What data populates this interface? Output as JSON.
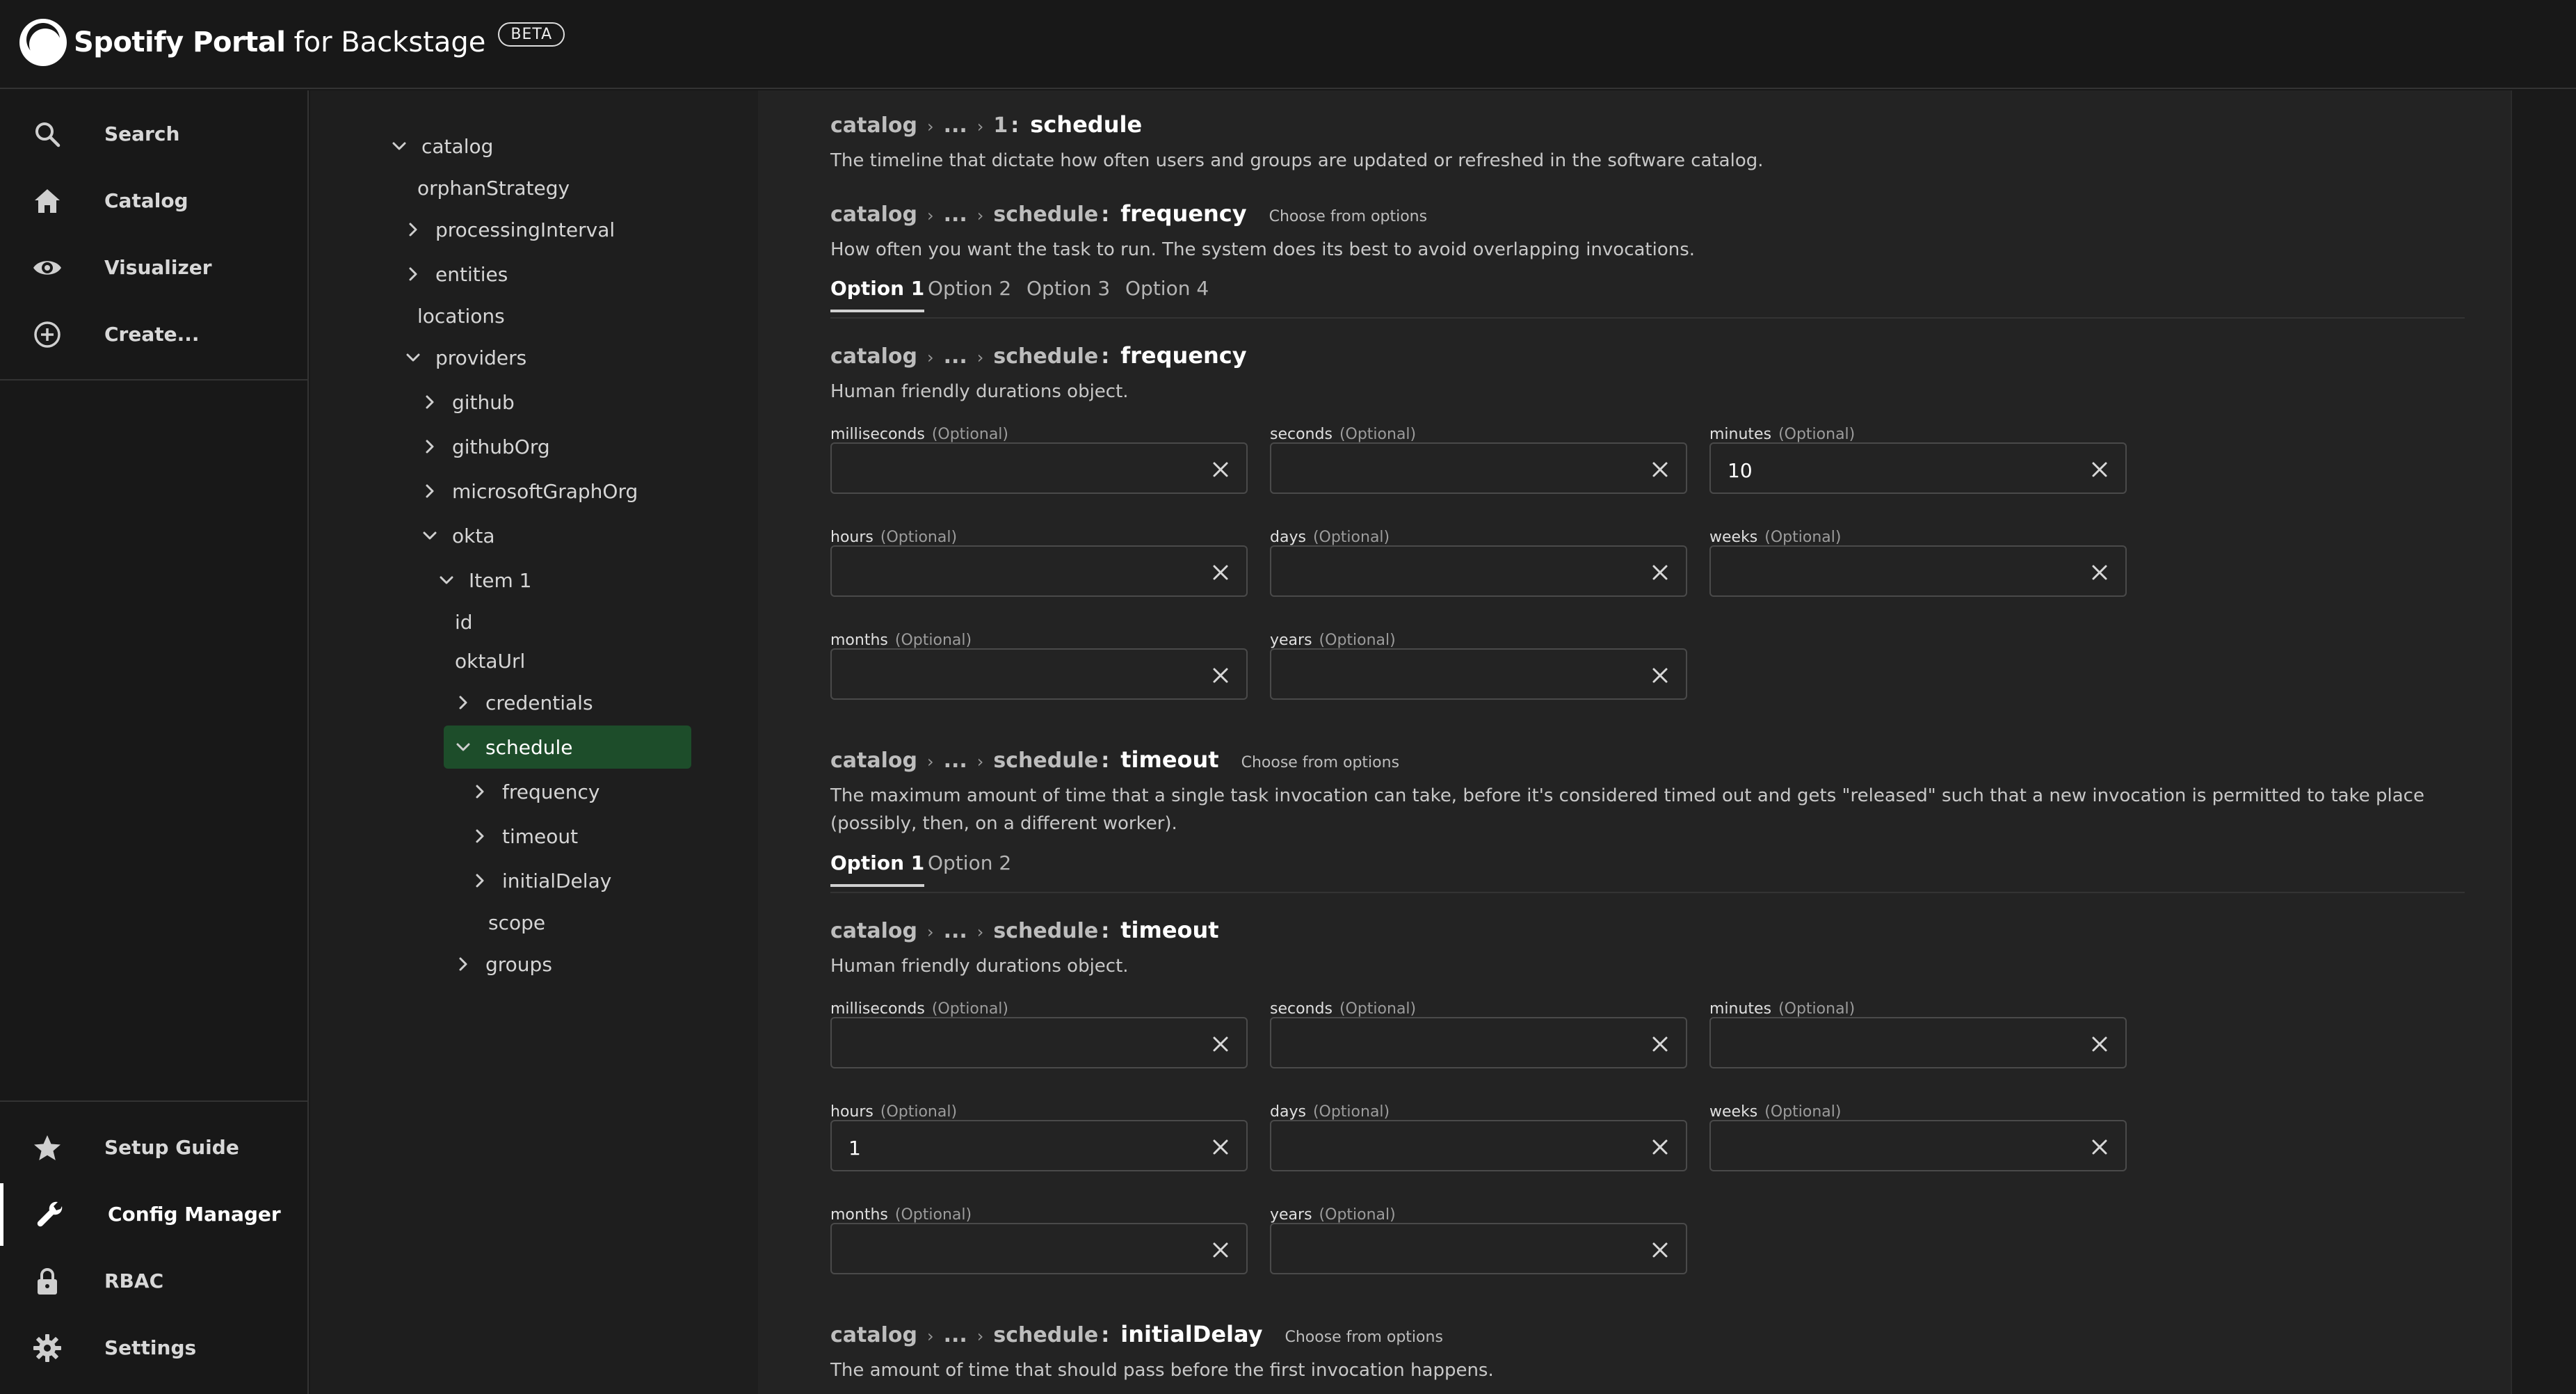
{
  "app": {
    "brand": "Spotify Portal",
    "brand_sub": "for Backstage",
    "beta": "BETA"
  },
  "nav": {
    "top": [
      {
        "label": "Search",
        "icon": "search-icon"
      },
      {
        "label": "Catalog",
        "icon": "home-icon"
      },
      {
        "label": "Visualizer",
        "icon": "eye-icon"
      },
      {
        "label": "Create...",
        "icon": "plus-circle-icon"
      }
    ],
    "bottom": [
      {
        "label": "Setup Guide",
        "icon": "star-icon"
      },
      {
        "label": "Config Manager",
        "icon": "wrench-icon",
        "active": true
      },
      {
        "label": "RBAC",
        "icon": "lock-icon"
      },
      {
        "label": "Settings",
        "icon": "gear-icon"
      }
    ]
  },
  "tree": [
    {
      "label": "catalog",
      "chev": "down"
    },
    {
      "label": "orphanStrategy",
      "chev": ""
    },
    {
      "label": "processingInterval",
      "chev": "right"
    },
    {
      "label": "entities",
      "chev": "right"
    },
    {
      "label": "locations",
      "chev": ""
    },
    {
      "label": "providers",
      "chev": "down"
    },
    {
      "label": "github",
      "chev": "right"
    },
    {
      "label": "githubOrg",
      "chev": "right"
    },
    {
      "label": "microsoftGraphOrg",
      "chev": "right"
    },
    {
      "label": "okta",
      "chev": "down"
    },
    {
      "label": "Item 1",
      "chev": "down"
    },
    {
      "label": "id",
      "chev": ""
    },
    {
      "label": "oktaUrl",
      "chev": ""
    },
    {
      "label": "credentials",
      "chev": "right"
    },
    {
      "label": "schedule",
      "chev": "down",
      "selected": true
    },
    {
      "label": "frequency",
      "chev": "right"
    },
    {
      "label": "timeout",
      "chev": "right"
    },
    {
      "label": "initialDelay",
      "chev": "right"
    },
    {
      "label": "scope",
      "chev": ""
    },
    {
      "label": "groups",
      "chev": "right"
    }
  ],
  "crumb_common": {
    "root": "catalog",
    "ellipsis": "...",
    "hint": "Choose from options"
  },
  "sections": {
    "schedule_header": {
      "parent": "1",
      "key": "schedule",
      "desc": "The timeline that dictate how often users and groups are updated or refreshed in the software catalog."
    },
    "frequency_opts": {
      "parent": "schedule",
      "key": "frequency",
      "desc": "How often you want the task to run. The system does its best to avoid overlapping invocations.",
      "tabs": [
        "Option 1",
        "Option 2",
        "Option 3",
        "Option 4"
      ]
    },
    "frequency_obj": {
      "parent": "schedule",
      "key": "frequency",
      "desc": "Human friendly durations object."
    },
    "timeout_opts": {
      "parent": "schedule",
      "key": "timeout",
      "desc": "The maximum amount of time that a single task invocation can take, before it's considered timed out and gets \"released\" such that a new invocation is permitted to take place (possibly, then, on a different worker).",
      "tabs": [
        "Option 1",
        "Option 2"
      ]
    },
    "timeout_obj": {
      "parent": "schedule",
      "key": "timeout",
      "desc": "Human friendly durations object."
    },
    "initialdelay_opts": {
      "parent": "schedule",
      "key": "initialDelay",
      "desc": "The amount of time that should pass before the first invocation happens."
    }
  },
  "optional_tag": "(Optional)",
  "frequency_fields": [
    {
      "label": "milliseconds",
      "value": ""
    },
    {
      "label": "seconds",
      "value": ""
    },
    {
      "label": "minutes",
      "value": "10"
    },
    {
      "label": "hours",
      "value": ""
    },
    {
      "label": "days",
      "value": ""
    },
    {
      "label": "weeks",
      "value": ""
    },
    {
      "label": "months",
      "value": ""
    },
    {
      "label": "years",
      "value": ""
    }
  ],
  "timeout_fields": [
    {
      "label": "milliseconds",
      "value": ""
    },
    {
      "label": "seconds",
      "value": ""
    },
    {
      "label": "minutes",
      "value": ""
    },
    {
      "label": "hours",
      "value": "1"
    },
    {
      "label": "days",
      "value": ""
    },
    {
      "label": "weeks",
      "value": ""
    },
    {
      "label": "months",
      "value": ""
    },
    {
      "label": "years",
      "value": ""
    }
  ]
}
